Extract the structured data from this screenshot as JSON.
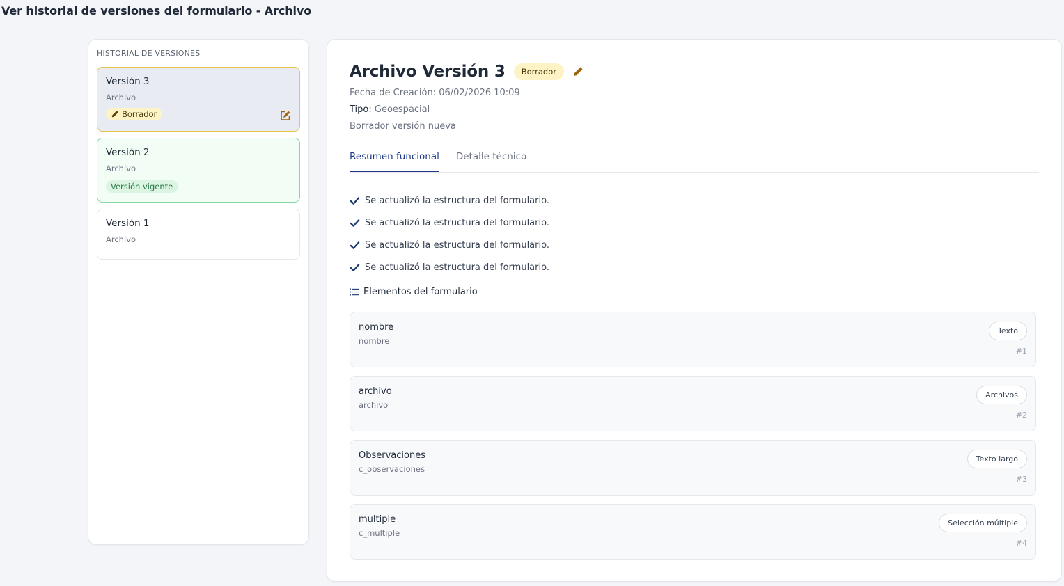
{
  "page": {
    "title": "Ver historial de versiones del formulario - Archivo"
  },
  "history": {
    "heading": "HISTORIAL DE VERSIONES",
    "versions": [
      {
        "name": "Versión 3",
        "type": "Archivo",
        "badge": "Borrador"
      },
      {
        "name": "Versión 2",
        "type": "Archivo",
        "badge": "Versión vigente"
      },
      {
        "name": "Versión 1",
        "type": "Archivo"
      }
    ]
  },
  "detail": {
    "title": "Archivo Versión 3",
    "status_badge": "Borrador",
    "created": "Fecha de Creación: 06/02/2026 10:09",
    "type_label": "Tipo:",
    "type_value": "Geoespacial",
    "description": "Borrador versión nueva",
    "tabs": [
      "Resumen funcional",
      "Detalle técnico"
    ],
    "changes": [
      "Se actualizó la estructura del formulario.",
      "Se actualizó la estructura del formulario.",
      "Se actualizó la estructura del formulario.",
      "Se actualizó la estructura del formulario."
    ],
    "elements_heading": "Elementos del formulario",
    "elements": [
      {
        "label": "nombre",
        "key": "nombre",
        "type": "Texto",
        "index": "#1"
      },
      {
        "label": "archivo",
        "key": "archivo",
        "type": "Archivos",
        "index": "#2"
      },
      {
        "label": "Observaciones",
        "key": "c_observaciones",
        "type": "Texto largo",
        "index": "#3"
      },
      {
        "label": "multiple",
        "key": "c_multiple",
        "type": "Selección múltiple",
        "index": "#4"
      }
    ]
  },
  "colors": {
    "accent": "#1e3a8a",
    "draft_bg": "#fdf3c4",
    "current_bg": "#dcf5e3",
    "edit_icon": "#a0640f"
  },
  "icons": {
    "pencil": "pencil-icon",
    "edit": "edit-square-icon",
    "check": "check-icon",
    "list": "list-icon"
  }
}
